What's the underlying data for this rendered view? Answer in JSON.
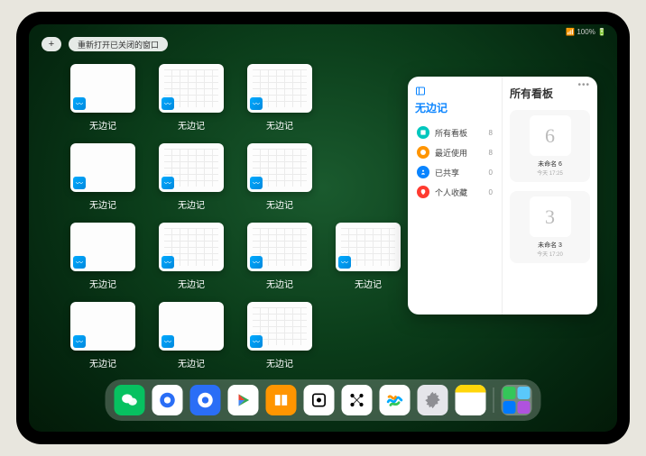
{
  "topbar": {
    "reopen_label": "重新打开已关闭的窗口"
  },
  "status": {
    "right": "📶 100% 🔋"
  },
  "thumbs": {
    "app_label": "无边记",
    "items": [
      {
        "variant": "blank"
      },
      {
        "variant": "cal"
      },
      {
        "variant": "cal"
      },
      {
        "variant": "blank"
      },
      {
        "variant": "cal"
      },
      {
        "variant": "cal"
      },
      {
        "variant": "blank"
      },
      {
        "variant": "cal"
      },
      {
        "variant": "cal"
      },
      {
        "variant": "cal"
      },
      {
        "variant": "blank"
      },
      {
        "variant": "blank"
      },
      {
        "variant": "cal"
      }
    ]
  },
  "panel": {
    "title": "无边记",
    "right_title": "所有看板",
    "nav": [
      {
        "label": "所有看板",
        "count": 8,
        "color": "#00c7be"
      },
      {
        "label": "最近使用",
        "count": 8,
        "color": "#ff9500"
      },
      {
        "label": "已共享",
        "count": 0,
        "color": "#0a84ff"
      },
      {
        "label": "个人收藏",
        "count": 0,
        "color": "#ff3b30"
      }
    ],
    "boards": [
      {
        "name": "未命名 6",
        "date": "今天 17:25",
        "sketch": "6"
      },
      {
        "name": "未命名 3",
        "date": "今天 17:20",
        "sketch": "3"
      }
    ]
  },
  "dock": {
    "apps": [
      {
        "name": "wechat",
        "bg": "#07c160",
        "glyph": "wechat"
      },
      {
        "name": "quark-hd",
        "bg": "#ffffff",
        "glyph": "quark-blue"
      },
      {
        "name": "quark",
        "bg": "#2a6ef6",
        "glyph": "quark-white"
      },
      {
        "name": "play",
        "bg": "#ffffff",
        "glyph": "play"
      },
      {
        "name": "books",
        "bg": "#ff9500",
        "glyph": "books"
      },
      {
        "name": "dice",
        "bg": "#ffffff",
        "glyph": "dice"
      },
      {
        "name": "connect",
        "bg": "#ffffff",
        "glyph": "dots"
      },
      {
        "name": "freeform",
        "bg": "#ffffff",
        "glyph": "freeform"
      },
      {
        "name": "settings",
        "bg": "#e5e5ea",
        "glyph": "gear"
      },
      {
        "name": "notes",
        "bg": "#ffffff",
        "glyph": "notes"
      }
    ]
  }
}
